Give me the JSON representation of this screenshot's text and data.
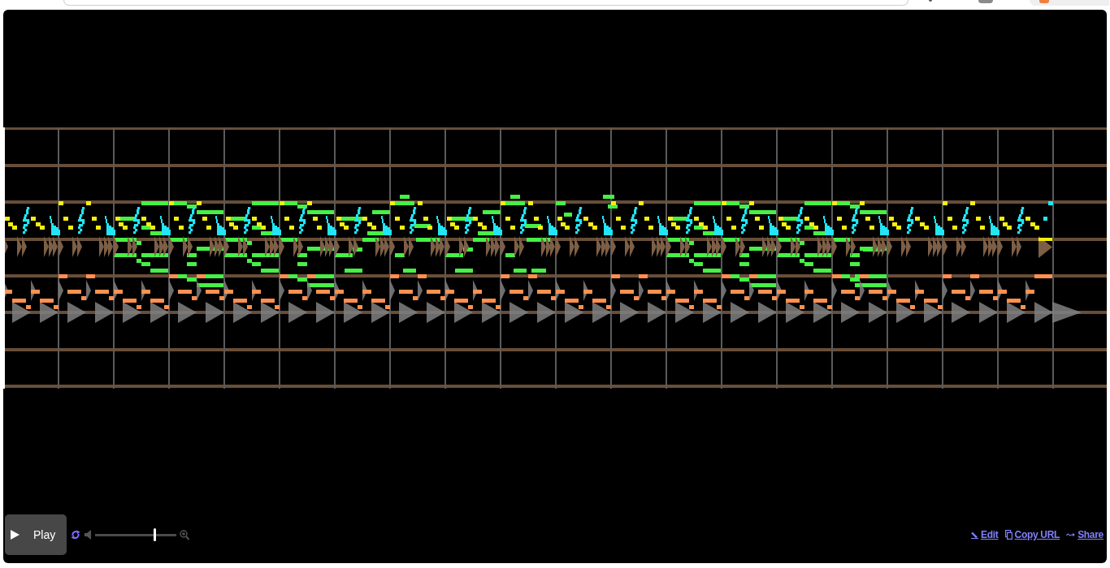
{
  "piano_roll": {
    "playhead": {
      "level": 0
    }
  },
  "controls": {
    "play_button": {
      "label": "Play"
    },
    "loop_button": {
      "on": true
    },
    "volume": {
      "level": 0.73
    }
  },
  "links": [
    {
      "kind": "edit",
      "label": "Edit"
    },
    {
      "kind": "copy",
      "label": "Copy URL"
    },
    {
      "kind": "share",
      "label": "Share"
    }
  ]
}
